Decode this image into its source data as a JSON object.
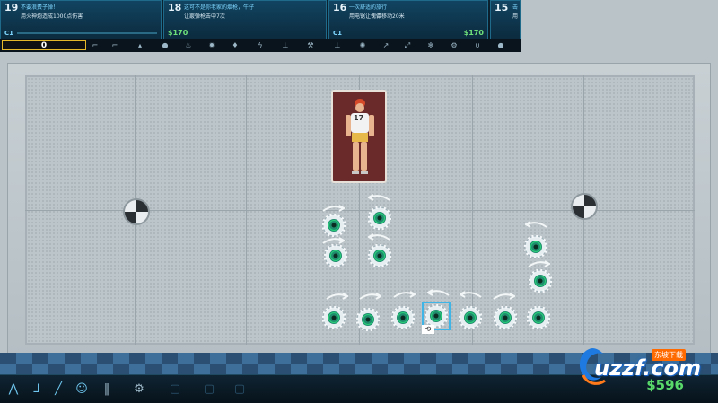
{
  "missions": [
    {
      "num": "19",
      "title": "不要浪费子弹！",
      "desc": "用火神炮造成1000点伤害",
      "tag": "C1"
    },
    {
      "num": "18",
      "title": "这可不是你老家的烟枪，牛仔",
      "desc": "让霰弹枪击中7次",
      "reward": "$170"
    },
    {
      "num": "16",
      "title": "一次舒适的旅行",
      "desc": "用电锯让傀儡移动20米",
      "tag": "C1",
      "reward": "$170"
    },
    {
      "num": "15",
      "title": "击",
      "desc": "用"
    }
  ],
  "toolbar": {
    "score": "0"
  },
  "dummy": {
    "number": "17"
  },
  "money": "$596",
  "watermark": {
    "text": "uzzf.com",
    "badge": "东坡下载"
  },
  "colors": {
    "accent": "#3fb4e6",
    "money": "#59d96a",
    "score_border": "#e6b92a"
  }
}
